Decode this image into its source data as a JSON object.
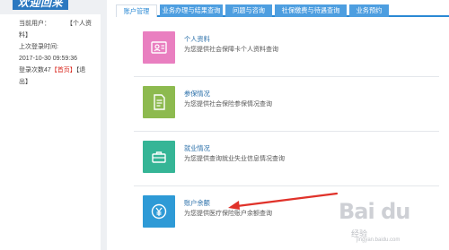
{
  "sidebar": {
    "welcome": "欢迎回来",
    "current_user_label": "当前用户：",
    "current_user_link": "【个人资",
    "current_user_link_cont": "料】",
    "last_login_label": "上次登录时间:",
    "last_login_time": "2017-10-30 09:59:36",
    "login_count_prefix": "登录次数47",
    "home_link": "【首页】",
    "logout_link": "【退",
    "logout_link_cont": "出】"
  },
  "tabs": [
    {
      "label": "账户管理",
      "active": true
    },
    {
      "label": "业务办理与结果查询",
      "active": false
    },
    {
      "label": "问题与咨询",
      "active": false
    },
    {
      "label": "社保缴费与待遇查询",
      "active": false
    },
    {
      "label": "业务预约",
      "active": false
    }
  ],
  "services": [
    {
      "title": "个人资料",
      "desc": "为您提供社会保障卡个人资料查询",
      "color": "#e97fc0",
      "icon": "id-card-icon"
    },
    {
      "title": "参保情况",
      "desc": "为您提供社会保险参保情况查询",
      "color": "#8dba4f",
      "icon": "document-icon"
    },
    {
      "title": "就业情况",
      "desc": "为您提供查询就业失业信息情况查询",
      "color": "#35b596",
      "icon": "briefcase-icon"
    },
    {
      "title": "账户余额",
      "desc": "为您提供医疗保险账户余额查询",
      "color": "#2e9ad6",
      "icon": "yen-icon"
    }
  ],
  "watermark": {
    "brand": "Bai du",
    "sub": "经验",
    "url": "jingyan.baidu.com"
  }
}
